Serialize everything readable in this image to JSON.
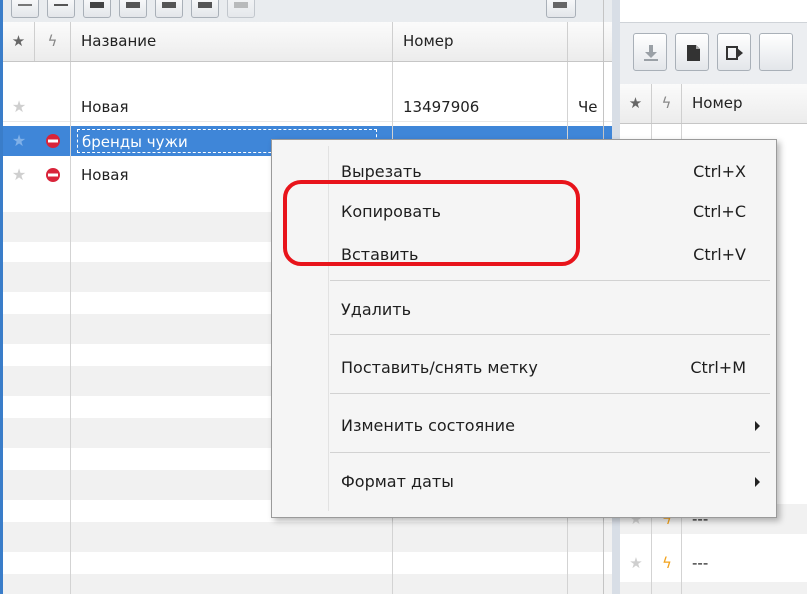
{
  "left_grid": {
    "headers": {
      "star": "★",
      "flash": "ϟ",
      "name": "Название",
      "number": "Номер"
    },
    "rows": [
      {
        "star": "★",
        "status": "",
        "name": "Новая",
        "number": "13497906",
        "extra": "Че"
      },
      {
        "star": "★",
        "status": "stop",
        "name": "бренды чужи",
        "number": "",
        "extra": ""
      },
      {
        "star": "★",
        "status": "stop",
        "name": "Новая",
        "number": "",
        "extra": ""
      }
    ]
  },
  "right_grid": {
    "headers": {
      "star": "★",
      "flash": "ϟ",
      "number": "Номер"
    },
    "rows": [
      {
        "star": "★",
        "flash": "ϟ",
        "number": "---"
      },
      {
        "star": "★",
        "flash": "ϟ",
        "number": "---"
      }
    ]
  },
  "context_menu": {
    "items": [
      {
        "label": "Вырезать",
        "shortcut": "Ctrl+X"
      },
      {
        "label": "Копировать",
        "shortcut": "Ctrl+C"
      },
      {
        "label": "Вставить",
        "shortcut": "Ctrl+V"
      },
      {
        "label": "Удалить",
        "shortcut": ""
      },
      {
        "label": "Поставить/снять метку",
        "shortcut": "Ctrl+M"
      },
      {
        "label": "Изменить состояние",
        "shortcut": ""
      },
      {
        "label": "Формат даты",
        "shortcut": ""
      }
    ]
  },
  "colors": {
    "selection": "#3f86d8",
    "highlight_ring": "#e8141b",
    "stop_icon": "#d9243a",
    "flash_orange": "#f2a21c",
    "star_grey": "#c9c9c9"
  },
  "icons": [
    "star-icon",
    "flash-icon",
    "stop-icon",
    "submenu-arrow-icon",
    "download-icon",
    "document-icon",
    "forward-icon"
  ]
}
